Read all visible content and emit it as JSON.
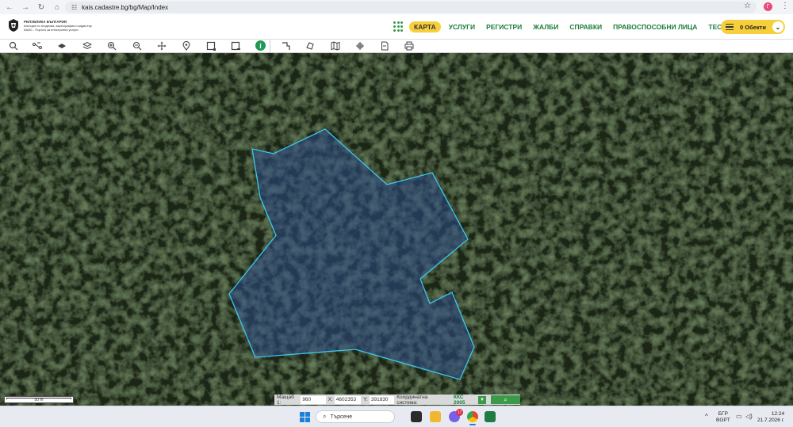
{
  "browser": {
    "url": "kais.cadastre.bg/bg/Map/Index",
    "profile_initial": "Г"
  },
  "header": {
    "logo_line1": "РЕПУБЛИКА БЪЛГАРИЯ",
    "logo_line2": "Агенция по геодезия, картография и кадастър",
    "logo_line3": "КАИС - Портал за електронни услуги",
    "menu": [
      {
        "label": "КАРТА",
        "active": true
      },
      {
        "label": "УСЛУГИ",
        "active": false
      },
      {
        "label": "РЕГИСТРИ",
        "active": false
      },
      {
        "label": "ЖАЛБИ",
        "active": false
      },
      {
        "label": "СПРАВКИ",
        "active": false
      },
      {
        "label": "ПРАВОСПОСОБНИ ЛИЦА",
        "active": false
      },
      {
        "label": "ТЕСТ",
        "active": false
      }
    ],
    "objects_button": "0 Обекти",
    "accent": "#f6cf3b",
    "brand_green": "#1a7d3a"
  },
  "toolbar": {
    "tools": [
      "search-icon",
      "measure-icon",
      "layers-icon",
      "layers-stack-icon",
      "zoom-in-icon",
      "zoom-out-icon",
      "pan-icon",
      "pin-icon",
      "select-rect-icon",
      "select-rect-clear-icon",
      "info-icon",
      "polyline-icon",
      "polygon-icon",
      "map-icon",
      "crosshair-icon",
      "document-icon",
      "print-icon"
    ],
    "info_label": "i"
  },
  "map": {
    "polygon_stroke": "#3cc8f0",
    "polygon_fill": "#2d4c8a"
  },
  "scale": {
    "label": "50 m"
  },
  "coords": {
    "scale_label": "Мащаб 1:",
    "scale_value": "960",
    "x_label": "X:",
    "x_value": "4602353",
    "y_label": "Y:",
    "y_value": "391830",
    "system_label": "Координатна система:",
    "system_value": "ККС 2005"
  },
  "taskbar": {
    "search_placeholder": "Търсене",
    "badge_count": "17",
    "lang_top": "БГР",
    "lang_bottom": "BGPT",
    "time": "12:24",
    "date": "21.7.2026 г."
  }
}
